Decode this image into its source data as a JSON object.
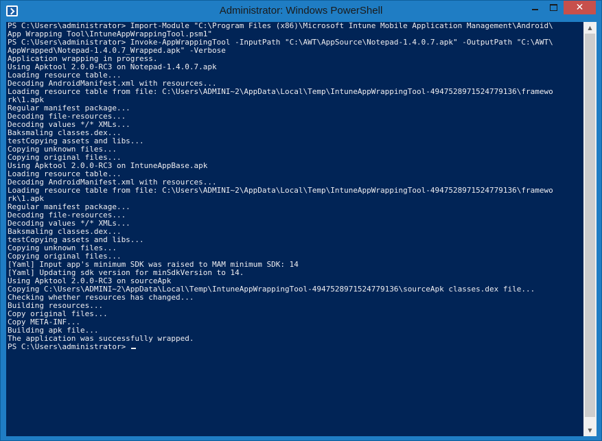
{
  "window": {
    "title": "Administrator: Windows PowerShell",
    "icon": "powershell-icon",
    "controls": {
      "minimize": "minimize-icon",
      "maximize": "maximize-icon",
      "close": "✕"
    }
  },
  "console": {
    "lines": [
      "PS C:\\Users\\administrator> Import-Module \"C:\\Program Files (x86)\\Microsoft Intune Mobile Application Management\\Android\\",
      "App Wrapping Tool\\IntuneAppWrappingTool.psm1\"",
      "PS C:\\Users\\administrator> Invoke-AppWrappingTool -InputPath \"C:\\AWT\\AppSource\\Notepad-1.4.0.7.apk\" -OutputPath \"C:\\AWT\\",
      "AppWrapped\\Notepad-1.4.0.7_Wrapped.apk\" -Verbose",
      "Application wrapping in progress.",
      "Using Apktool 2.0.0-RC3 on Notepad-1.4.0.7.apk",
      "Loading resource table...",
      "Decoding AndroidManifest.xml with resources...",
      "Loading resource table from file: C:\\Users\\ADMINI~2\\AppData\\Local\\Temp\\IntuneAppWrappingTool-4947528971524779136\\framewo",
      "rk\\1.apk",
      "Regular manifest package...",
      "Decoding file-resources...",
      "Decoding values */* XMLs...",
      "Baksmaling classes.dex...",
      "testCopying assets and libs...",
      "Copying unknown files...",
      "Copying original files...",
      "Using Apktool 2.0.0-RC3 on IntuneAppBase.apk",
      "Loading resource table...",
      "Decoding AndroidManifest.xml with resources...",
      "Loading resource table from file: C:\\Users\\ADMINI~2\\AppData\\Local\\Temp\\IntuneAppWrappingTool-4947528971524779136\\framewo",
      "rk\\1.apk",
      "Regular manifest package...",
      "Decoding file-resources...",
      "Decoding values */* XMLs...",
      "Baksmaling classes.dex...",
      "testCopying assets and libs...",
      "Copying unknown files...",
      "Copying original files...",
      "[Yaml] Input app's minimum SDK was raised to MAM minimum SDK: 14",
      "[Yaml] Updating sdk version for minSdkVersion to 14.",
      "Using Apktool 2.0.0-RC3 on sourceApk",
      "Copying C:\\Users\\ADMINI~2\\AppData\\Local\\Temp\\IntuneAppWrappingTool-4947528971524779136\\sourceApk classes.dex file...",
      "Checking whether resources has changed...",
      "Building resources...",
      "Copy original files...",
      "Copy META-INF...",
      "Building apk file...",
      "The application was successfully wrapped."
    ],
    "prompt": "PS C:\\Users\\administrator> "
  },
  "scrollbar": {
    "up_icon": "scroll-up-arrow-icon",
    "down_icon": "scroll-down-arrow-icon",
    "position_fraction": 0.0,
    "visible_fraction": 0.98
  },
  "colors": {
    "console_bg": "#012456",
    "console_fg": "#eeedf0",
    "title_bar": "#1f7dc4",
    "close_button": "#c7504c"
  }
}
